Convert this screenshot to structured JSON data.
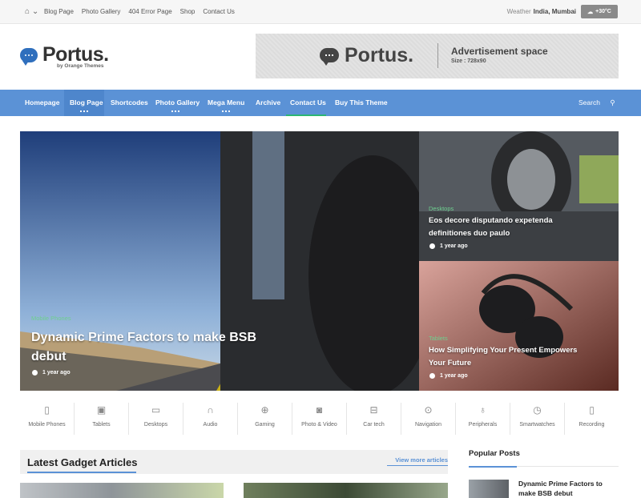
{
  "topbar": {
    "links": [
      "Blog Page",
      "Photo Gallery",
      "404 Error Page",
      "Shop",
      "Contact Us"
    ],
    "weather_label": "Weather",
    "location": "India, Mumbai",
    "temperature": "+30°C"
  },
  "header": {
    "logo_name": "Portus.",
    "logo_sub": "by Orange Themes",
    "ad": {
      "logo_name": "Portus.",
      "title": "Advertisement space",
      "size": "Size : 728x90"
    }
  },
  "nav": {
    "items": [
      "Homepage",
      "Blog Page",
      "Shortcodes",
      "Photo Gallery",
      "Mega Menu",
      "Archive",
      "Contact Us",
      "Buy This Theme"
    ],
    "search_label": "Search"
  },
  "hero": {
    "main": {
      "category": "Mobile Phones",
      "title_line1": "Dynamic Prime Factors to make BSB",
      "title_line2": "debut",
      "date": "1 year ago"
    },
    "side1": {
      "category": "Desktops",
      "title_line1": "Eos decore disputando expetenda",
      "title_line2": "definitiones duo paulo",
      "date": "1 year ago"
    },
    "side2": {
      "category": "Tablets",
      "title_line1": "How Simplifying Your Present Empowers",
      "title_line2": "Your Future",
      "date": "1 year ago"
    }
  },
  "categories": [
    {
      "label": "Mobile Phones",
      "icon": "phone-icon"
    },
    {
      "label": "Tablets",
      "icon": "tablet-icon"
    },
    {
      "label": "Desktops",
      "icon": "desktop-icon"
    },
    {
      "label": "Audio",
      "icon": "headphones-icon"
    },
    {
      "label": "Gaming",
      "icon": "gamepad-icon"
    },
    {
      "label": "Photo & Video",
      "icon": "camera-icon"
    },
    {
      "label": "Car tech",
      "icon": "car-icon"
    },
    {
      "label": "Navigation",
      "icon": "map-pin-icon"
    },
    {
      "label": "Peripherals",
      "icon": "microphone-icon"
    },
    {
      "label": "Smartwatches",
      "icon": "clock-icon"
    },
    {
      "label": "Recording",
      "icon": "mouse-icon"
    }
  ],
  "latest": {
    "title": "Latest Gadget Articles",
    "more": "View more articles"
  },
  "popular": {
    "title": "Popular Posts",
    "first_line1": "Dynamic Prime Factors to",
    "first_line2": "make BSB debut"
  },
  "colors": {
    "nav": "#5b92d6",
    "accent_green": "#2bb673",
    "logo_blue": "#2f6fbd"
  }
}
